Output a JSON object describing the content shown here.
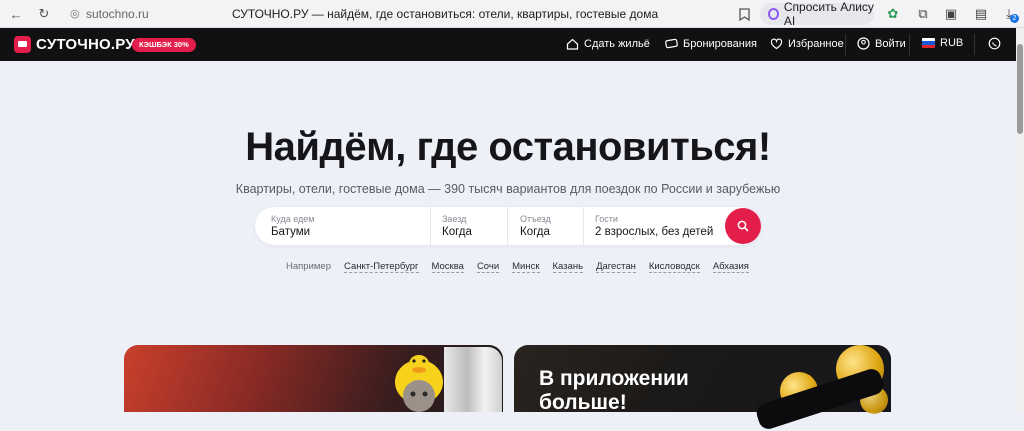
{
  "browser": {
    "url_domain": "sutochno.ru",
    "tab_title": "СУТОЧНО.РУ — найдём, где остановиться: отели, квартиры, гостевые дома",
    "alisa_label": "Спросить Алису AI",
    "download_badge": "2"
  },
  "header": {
    "logo_text": "СУТОЧНО.РУ",
    "cashback_label": "КЭШБЭК 30%",
    "nav": {
      "rent_out": "Сдать жильё",
      "bookings": "Бронирования",
      "favorites": "Избранное",
      "login": "Войти",
      "currency": "RUB"
    }
  },
  "hero": {
    "title": "Найдём, где остановиться!",
    "subtitle": "Квартиры, отели, гостевые дома — 390 тысяч вариантов для поездок по России и зарубежью"
  },
  "search": {
    "destination_label": "Куда едем",
    "destination_value": "Батуми",
    "checkin_label": "Заезд",
    "checkin_value": "Когда",
    "checkout_label": "Отъезд",
    "checkout_value": "Когда",
    "guests_label": "Гости",
    "guests_value": "2 взрослых, без детей"
  },
  "examples": {
    "label": "Например",
    "cities": [
      "Санкт-Петербург",
      "Москва",
      "Сочи",
      "Минск",
      "Казань",
      "Дагестан",
      "Кисловодск",
      "Абхазия"
    ]
  },
  "promo": {
    "app_title": "В приложении больше!"
  },
  "colors": {
    "brand": "#e31e4b",
    "header_bg": "#111114",
    "page_bg": "#eef0f8"
  }
}
